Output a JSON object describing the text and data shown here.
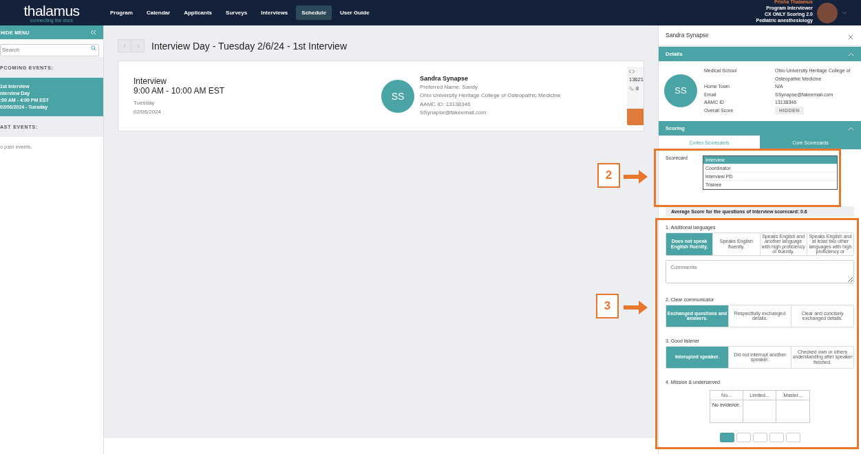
{
  "nav": {
    "logo": "thalamus",
    "tagline": "connecting the docs",
    "items": [
      {
        "label": "Program",
        "selected": false
      },
      {
        "label": "Calendar",
        "selected": false
      },
      {
        "label": "Applicants",
        "selected": false
      },
      {
        "label": "Surveys",
        "selected": false
      },
      {
        "label": "Interviews",
        "selected": false
      },
      {
        "label": "Schedule",
        "selected": true
      },
      {
        "label": "User Guide",
        "selected": false
      }
    ],
    "user": {
      "name": "Prisha Thalamus",
      "lines": [
        "Program Interviewer",
        "CX ONLY Scoring 2.0",
        "Pediatric anesthesiology"
      ]
    }
  },
  "sidebar": {
    "hide_label": "HIDE MENU",
    "search_placeholder": "Search",
    "upcoming_heading": "PCOMING EVENTS:",
    "events": [
      {
        "lines": [
          "1st Interview",
          "nterview Day",
          ":00 AM - 4:00 PM EST",
          "02/06/2024 - Tuesday"
        ],
        "selected": true
      }
    ],
    "past_heading": "AST EVENTS:",
    "past_empty": "o past events."
  },
  "main": {
    "title": "Interview Day - Tuesday 2/6/24 - 1st Interview",
    "card": {
      "type": "Interview",
      "time": "9:00 AM - 10:00 AM EST",
      "day": "Tuesday",
      "date": "02/06/2024",
      "initials": "SS",
      "name": "Sandra Synapse",
      "details": [
        "Preferred Name: Sandy",
        "Ohio University Heritage College of Osteopathic Medicine",
        "AAMC ID: 13138346",
        "SSynapse@fakeemail.com"
      ],
      "side_id": "13621",
      "side_phone": "8"
    }
  },
  "panel": {
    "title": "Sandra Synapse",
    "details": {
      "heading": "Details",
      "expanded": true,
      "initials": "SS",
      "fields": [
        {
          "label": "Medical School",
          "value": "Ohio University Heritage College of Osteopathic Medicine"
        },
        {
          "label": "Home Town",
          "value": "N/A"
        },
        {
          "label": "Email",
          "value": "SSynapse@fakeemail.com"
        },
        {
          "label": "AAMC ID",
          "value": "13138346"
        },
        {
          "label": "Overall Score",
          "value": "HIDDEN",
          "kind": "badge"
        }
      ]
    },
    "scoring": {
      "heading": "Scoring",
      "expanded": true,
      "tabs": [
        {
          "label": "Cortex Scorecards",
          "selected": false
        },
        {
          "label": "Core Scorecards",
          "selected": true
        }
      ],
      "scorecard_label": "Scorecard",
      "scorecards": [
        {
          "label": "Interview",
          "selected": true
        },
        {
          "label": "Coordinator",
          "selected": false
        },
        {
          "label": "Interview PD",
          "selected": false
        },
        {
          "label": "Trainee",
          "selected": false
        }
      ],
      "average": "Average Score for the questions of Interview scorecard:  0.6",
      "questions": [
        {
          "title": "1. Additional languages",
          "kind": "options",
          "comments_placeholder": "Comments",
          "options": [
            {
              "label": "Does not speak English fluently.",
              "selected": true
            },
            {
              "label": "Speaks English fluently.",
              "selected": false
            },
            {
              "label": "Speaks English and another language with high proficiency or fluently.",
              "selected": false
            },
            {
              "label": "Speaks English and at least two other languages with high proficiency or",
              "selected": false
            }
          ]
        },
        {
          "title": "2. Clear communicator",
          "kind": "options",
          "options": [
            {
              "label": "Exchanged questions and answers.",
              "selected": true
            },
            {
              "label": "Respectfully exchanged details.",
              "selected": false
            },
            {
              "label": "Clear and concisely exchanged details.",
              "selected": false
            }
          ]
        },
        {
          "title": "3. Good listener",
          "kind": "options",
          "options": [
            {
              "label": "Interupted speaker.",
              "selected": true
            },
            {
              "label": "Did not interrupt another speaker.",
              "selected": false
            },
            {
              "label": "Checked own or others understanding after speaker finished.",
              "selected": false
            }
          ]
        },
        {
          "title": "4. Mission & underserved",
          "kind": "table",
          "columns": [
            "No...",
            "Limited...",
            "Master..."
          ],
          "cells": [
            "No evidence.",
            "",
            ""
          ]
        }
      ],
      "pages": [
        {
          "selected": true
        },
        {
          "selected": false
        },
        {
          "selected": false
        },
        {
          "selected": false
        },
        {
          "selected": false
        }
      ]
    }
  },
  "annotations": [
    {
      "label": "2"
    },
    {
      "label": "3"
    }
  ]
}
